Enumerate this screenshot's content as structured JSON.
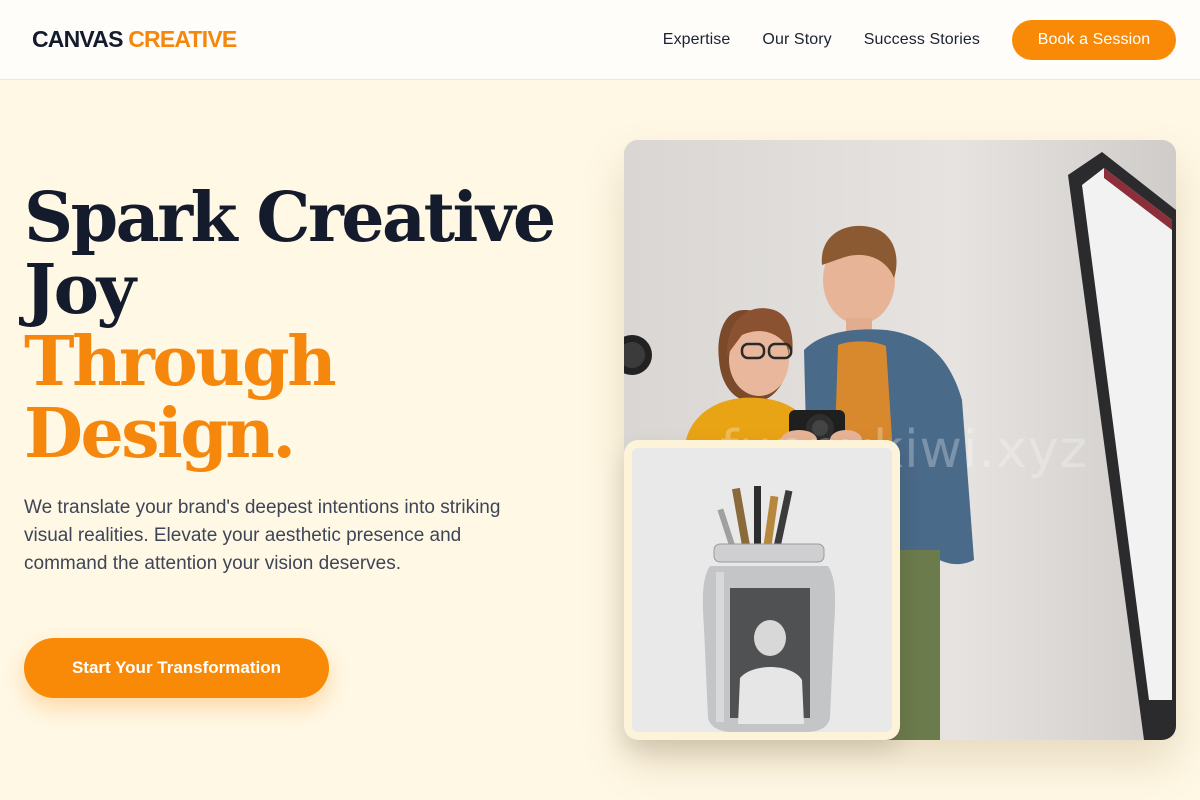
{
  "nav": {
    "brand_part1": "CANVAS",
    "brand_part2": "CREATIVE",
    "links": [
      "Expertise",
      "Our Story",
      "Success Stories"
    ],
    "cta_label": "Book a Session"
  },
  "hero": {
    "title_line1": "Spark Creative",
    "title_line2": "Joy",
    "title_accent1": "Through",
    "title_accent2": "Design.",
    "description": "We translate your brand's deepest intentions into striking visual realities. Elevate your aesthetic presence and command the attention your vision deserves.",
    "cta_label": "Start Your Transformation"
  },
  "images": {
    "main_alt": "Two photographers reviewing shots on a camera in a studio",
    "inset_alt": "Glass jar filled with paintbrushes"
  },
  "watermark": "funnykiwi.xyz",
  "colors": {
    "accent": "#f98a07",
    "dark_text": "#141b2d",
    "page_background": "#fff8e5"
  }
}
